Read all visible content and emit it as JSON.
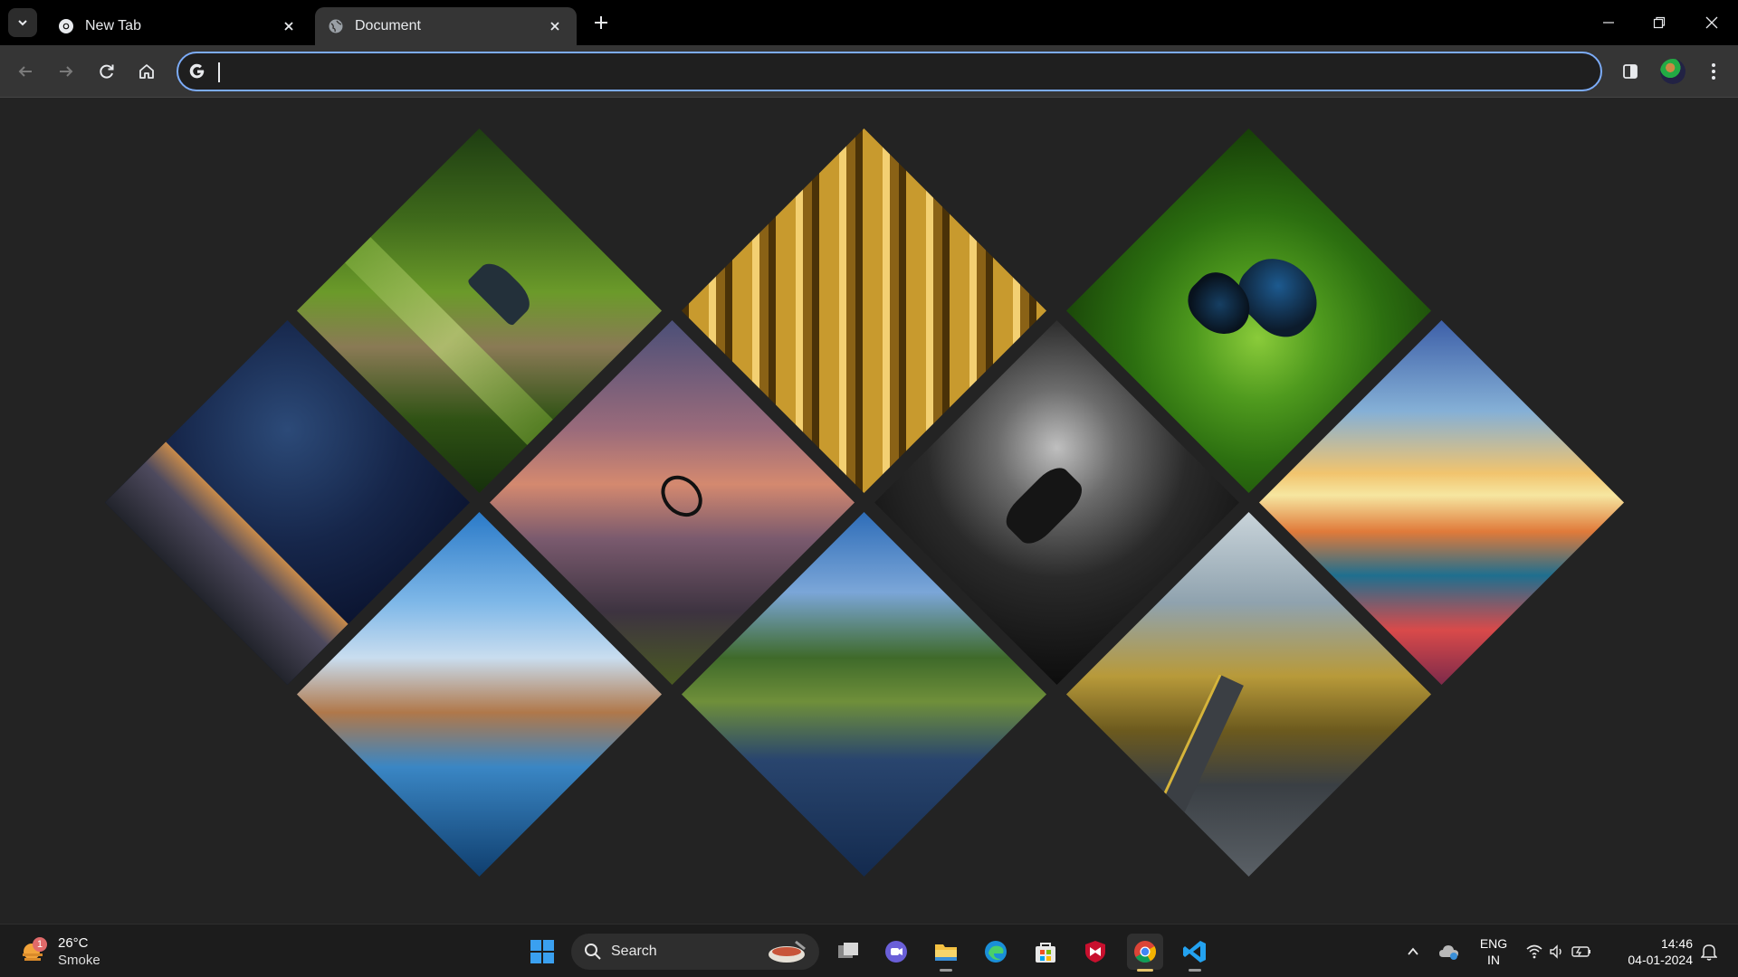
{
  "browser": {
    "tabs": [
      {
        "title": "New Tab",
        "active": false,
        "favicon": "chrome-icon"
      },
      {
        "title": "Document",
        "active": true,
        "favicon": "globe-icon"
      }
    ],
    "omnibox": {
      "value": "",
      "placeholder": ""
    }
  },
  "gallery": {
    "tiles": [
      {
        "subject": "forest path with benches"
      },
      {
        "subject": "stacked gold bars"
      },
      {
        "subject": "blue butterfly on leaves"
      },
      {
        "subject": "starry night sky over mountains"
      },
      {
        "subject": "mountain biker at sunset"
      },
      {
        "subject": "motorcyclist on wet road"
      },
      {
        "subject": "colorful sunset over sea waves"
      },
      {
        "subject": "river with autumn trees"
      },
      {
        "subject": "lake with green trees"
      },
      {
        "subject": "winding mountain road in autumn"
      }
    ]
  },
  "taskbar": {
    "weather": {
      "badge": "1",
      "temp": "26°C",
      "condition": "Smoke"
    },
    "search_label": "Search",
    "apps": [
      "task-view-icon",
      "teams-icon",
      "file-explorer-icon",
      "edge-icon",
      "store-icon",
      "mcafee-icon",
      "chrome-icon",
      "vscode-icon"
    ],
    "tray": {
      "lang1": "ENG",
      "lang2": "IN",
      "time": "14:46",
      "date": "04-01-2024"
    }
  },
  "colors": {
    "accent": "#7cacf8",
    "page_bg": "#232323",
    "chrome_bg": "#353535"
  }
}
